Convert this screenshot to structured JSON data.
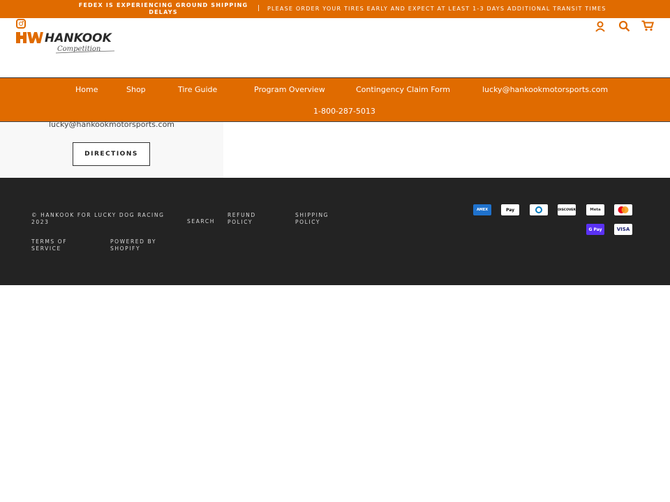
{
  "announcement": {
    "left": "FEDEX IS EXPERIENCING GROUND SHIPPING DELAYS",
    "separator": "|",
    "right": "PLEASE ORDER YOUR TIRES EARLY AND EXPECT AT LEAST 1-3 DAYS ADDITIONAL TRANSIT TIMES"
  },
  "brand": {
    "name": "HANKOOK",
    "sub": "Competition",
    "color": "#e06b00"
  },
  "nav": {
    "items": [
      "Home",
      "Shop",
      "Tire Guide",
      "Program Overview",
      "Contingency Claim Form",
      "lucky@hankookmotorsports.com",
      "1-800-287-5013"
    ]
  },
  "contact": {
    "email": "lucky@hankookmotorsports.com",
    "directions_label": "DIRECTIONS"
  },
  "footer": {
    "copyright": "© HANKOOK FOR LUCKY DOG RACING 2023",
    "links": [
      "SEARCH",
      "REFUND POLICY",
      "SHIPPING POLICY",
      "TERMS OF SERVICE",
      "POWERED BY SHOPIFY"
    ],
    "payments": [
      "AMEX",
      "Pay",
      "Diners Club",
      "DISCOVER",
      "Meta",
      "Mastercard",
      "G Pay",
      "VISA"
    ]
  }
}
